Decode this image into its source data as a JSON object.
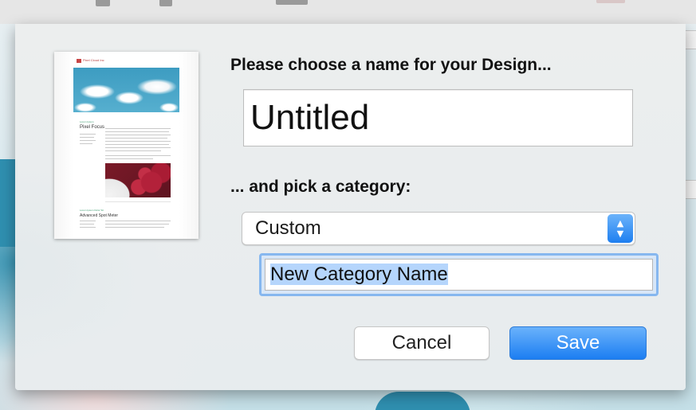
{
  "dialog": {
    "name_prompt": "Please choose a name for your Design...",
    "name_value": "Untitled",
    "category_prompt": "... and pick a category:",
    "category_selected": "Custom",
    "new_category_value": "New Category Name",
    "cancel_label": "Cancel",
    "save_label": "Save"
  },
  "thumbnail": {
    "logo_text": "Pixel Cloud Inc",
    "section1_kicker": "Lorem Ipsum",
    "section1_title": "Pixel Focus",
    "section2_kicker": "Lorem Ipsum Dolor Sit",
    "section2_title": "Advanced Spot Meter"
  },
  "icons": {
    "stepper": "up-down-chevron-icon"
  },
  "colors": {
    "accent": "#1e7ff0",
    "focus_ring": "#86b7ef",
    "selection": "#b5d5fc"
  }
}
